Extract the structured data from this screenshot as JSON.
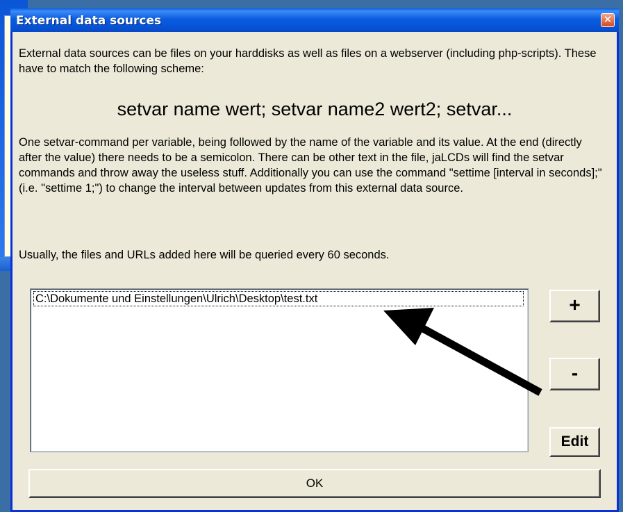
{
  "window": {
    "title": "External data sources",
    "close_glyph": "✕"
  },
  "content": {
    "intro": "External data sources can be files on your harddisks as well as files on a webserver (including php-scripts). These have to match the following scheme:",
    "scheme": "setvar name wert; setvar name2 wert2; setvar...",
    "explanation": "One setvar-command per variable, being followed by the name of the variable and its value. At the end (directly after the value) there needs to be a semicolon. There can be other text in the file, jaLCDs will find the setvar commands and throw away the useless stuff. Additionally you can use the command \"settime [interval in seconds];\" (i.e. \"settime 1;\") to change the interval between updates from this external data source.",
    "query_note": "Usually, the files and URLs added here will be queried every 60 seconds."
  },
  "sources_list": {
    "items": [
      "C:\\Dokumente und Einstellungen\\Ulrich\\Desktop\\test.txt"
    ]
  },
  "buttons": {
    "add": "+",
    "remove": "-",
    "edit": "Edit",
    "ok": "OK"
  },
  "colors": {
    "titlebar": "#0553d6",
    "dialog_bg": "#ece9d8",
    "close_button": "#d8481e",
    "annotation_arrow": "#000000"
  }
}
